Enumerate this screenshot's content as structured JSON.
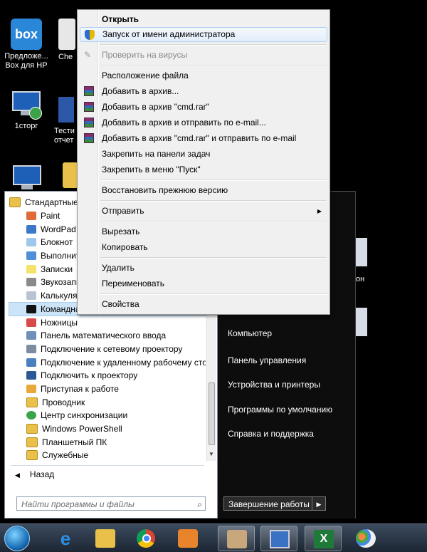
{
  "desktop": {
    "icons": [
      {
        "label": "Предложе... Box для HP",
        "icon": "box-app-icon"
      },
      {
        "label": "Che",
        "icon": "shortcut-icon"
      },
      {
        "label": "1сторг",
        "icon": "network-computer-icon"
      },
      {
        "label": "Тести отчет",
        "icon": "shortcut-icon"
      }
    ],
    "right_icon_fragment": "он"
  },
  "context_menu": {
    "items": [
      {
        "label": "Открыть",
        "bold": true
      },
      {
        "label": "Запуск от имени администратора",
        "icon": "shield-icon"
      },
      {
        "label": "Проверить на вирусы",
        "disabled": true
      },
      {
        "label": "Расположение файла"
      },
      {
        "label": "Добавить в архив...",
        "icon": "winrar-icon"
      },
      {
        "label": "Добавить в архив \"cmd.rar\"",
        "icon": "winrar-icon"
      },
      {
        "label": "Добавить в архив и отправить по e-mail...",
        "icon": "winrar-icon"
      },
      {
        "label": "Добавить в архив \"cmd.rar\" и отправить по e-mail",
        "icon": "winrar-icon"
      },
      {
        "label": "Закрепить на панели задач"
      },
      {
        "label": "Закрепить в меню \"Пуск\""
      },
      {
        "label": "Восстановить прежнюю версию"
      },
      {
        "label": "Отправить",
        "submenu": true
      },
      {
        "label": "Вырезать"
      },
      {
        "label": "Копировать"
      },
      {
        "label": "Удалить"
      },
      {
        "label": "Переименовать"
      },
      {
        "label": "Свойства"
      }
    ]
  },
  "start_menu": {
    "programs": [
      {
        "label": "Стандартные",
        "icon": "folder-icon"
      },
      {
        "label": "Paint",
        "icon": "paint-icon"
      },
      {
        "label": "WordPad",
        "icon": "wordpad-icon"
      },
      {
        "label": "Блокнот",
        "icon": "notepad-icon"
      },
      {
        "label": "Выполнить",
        "icon": "run-icon"
      },
      {
        "label": "Записки",
        "icon": "sticky-notes-icon"
      },
      {
        "label": "Звукозапись",
        "icon": "sound-recorder-icon"
      },
      {
        "label": "Калькулятор",
        "icon": "calculator-icon"
      },
      {
        "label": "Командная строка",
        "icon": "cmd-icon",
        "selected": true
      },
      {
        "label": "Ножницы",
        "icon": "snipping-tool-icon"
      },
      {
        "label": "Панель математического ввода",
        "icon": "math-input-icon"
      },
      {
        "label": "Подключение к сетевому проектору",
        "icon": "network-projector-icon"
      },
      {
        "label": "Подключение к удаленному рабочему столу",
        "icon": "remote-desktop-icon"
      },
      {
        "label": "Подключить к проектору",
        "icon": "projector-icon"
      },
      {
        "label": "Приступая к работе",
        "icon": "getting-started-icon"
      },
      {
        "label": "Проводник",
        "icon": "explorer-icon"
      },
      {
        "label": "Центр синхронизации",
        "icon": "sync-center-icon"
      },
      {
        "label": "Windows PowerShell",
        "icon": "folder-icon"
      },
      {
        "label": "Планшетный ПК",
        "icon": "folder-icon"
      },
      {
        "label": "Служебные",
        "icon": "folder-icon"
      }
    ],
    "back_label": "Назад",
    "search_placeholder": "Найти программы и файлы",
    "right_items": [
      "Компьютер",
      "Панель управления",
      "Устройства и принтеры",
      "Программы по умолчанию",
      "Справка и поддержка"
    ],
    "shutdown_label": "Завершение работы"
  },
  "taskbar": {
    "buttons": [
      "start-orb",
      "internet-explorer-icon",
      "file-explorer-icon",
      "chrome-icon",
      "media-player-icon",
      "user-app-icon",
      "network-icon",
      "excel-icon",
      "paint-icon"
    ]
  }
}
